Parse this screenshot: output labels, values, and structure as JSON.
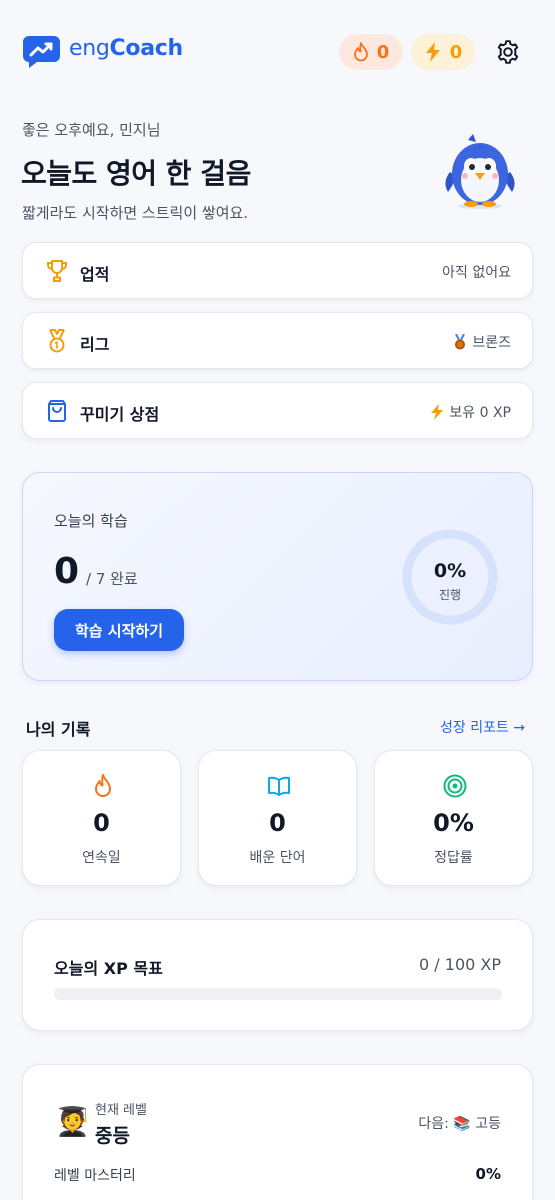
{
  "header": {
    "logo_prefix": "eng",
    "logo_suffix": "Coach",
    "streak_count": "0",
    "xp_count": "0",
    "brand_color": "#2563eb"
  },
  "greeting": {
    "small": "좋은 오후예요, 민지님",
    "title": "오늘도 영어 한 걸음",
    "subtitle": "짧게라도 시작하면 스트릭이 쌓여요."
  },
  "menu": [
    {
      "label": "업적",
      "right": "아직 없어요",
      "icon": "trophy-icon"
    },
    {
      "label": "리그",
      "right": "브론즈",
      "icon": "medal-icon",
      "right_icon": "bronze-medal-icon"
    },
    {
      "label": "꾸미기 상점",
      "right": "보유 0 XP",
      "icon": "shopping-bag-icon",
      "right_icon": "lightning-icon"
    }
  ],
  "today": {
    "label": "오늘의 학습",
    "done": "0",
    "total": "/ 7 완료",
    "button": "학습 시작하기",
    "progress_text": "0%",
    "progress_label": "진행",
    "progress": 0
  },
  "records": {
    "title": "나의 기록",
    "link": "성장 리포트 →",
    "stats": [
      {
        "value": "0",
        "label": "연속일",
        "icon": "flame-icon"
      },
      {
        "value": "0",
        "label": "배운 단어",
        "icon": "book-icon"
      },
      {
        "value": "0%",
        "label": "정답률",
        "icon": "target-icon"
      }
    ]
  },
  "xp_goal": {
    "title": "오늘의 XP 목표",
    "value": "0 / 100 XP",
    "progress": 0
  },
  "level": {
    "emoji": "🧑‍🎓",
    "current_label": "현재 레벨",
    "name": "중등",
    "next": "다음: 📚 고등",
    "mastery_label": "레벨 마스터리",
    "mastery_value": "0%"
  }
}
